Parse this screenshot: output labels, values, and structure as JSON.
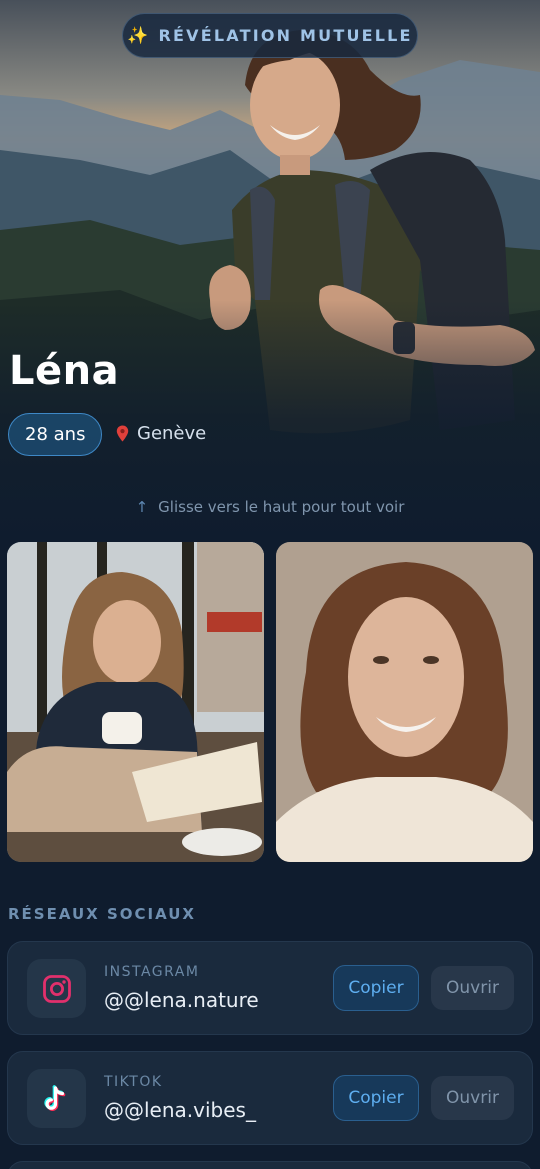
{
  "badge": {
    "icon": "sparkles-icon",
    "label": "RÉVÉLATION MUTUELLE"
  },
  "profile": {
    "name": "Léna",
    "age": "28 ans",
    "location": "Genève",
    "location_icon": "map-pin-icon"
  },
  "hint": {
    "icon": "arrow-up-icon",
    "text": "Glisse vers le haut pour tout voir"
  },
  "photos": [
    {
      "alt": "woman-reading-cafe-photo"
    },
    {
      "alt": "woman-portrait-photo"
    }
  ],
  "socials": {
    "title": "RÉSEAUX SOCIAUX",
    "items": [
      {
        "network": "INSTAGRAM",
        "handle": "@@lena.nature",
        "icon": "instagram-icon",
        "copy_label": "Copier",
        "open_label": "Ouvrir"
      },
      {
        "network": "TIKTOK",
        "handle": "@@lena.vibes_",
        "icon": "tiktok-icon",
        "copy_label": "Copier",
        "open_label": "Ouvrir"
      }
    ]
  },
  "colors": {
    "background": "#0f1c2e",
    "accent": "#3e88c6",
    "card": "#1a2a3d",
    "instagram": "#e1306c",
    "tiktok_cyan": "#25f4ee",
    "tiktok_red": "#fe2c55"
  }
}
